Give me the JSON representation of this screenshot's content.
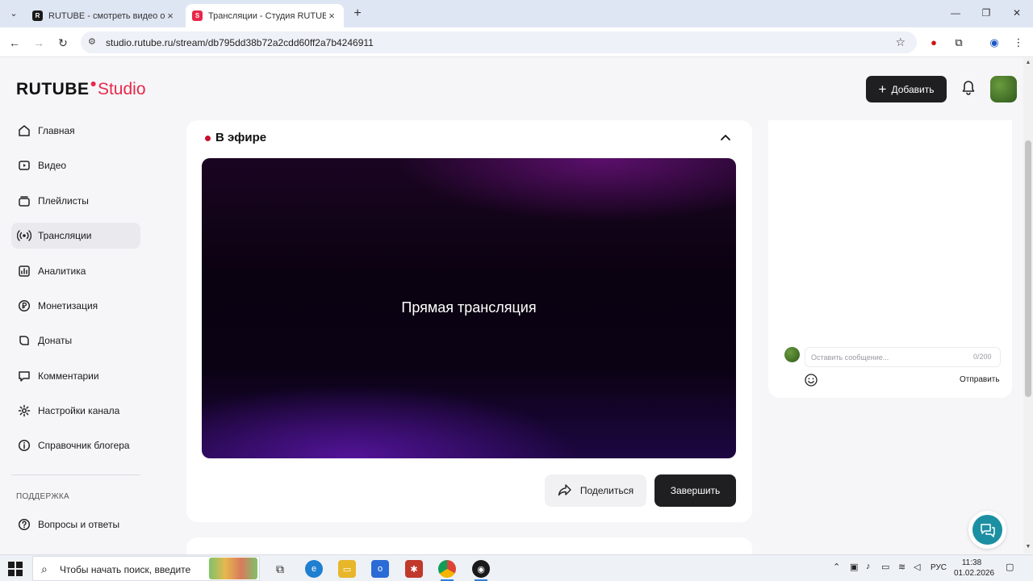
{
  "browser": {
    "tabs": [
      {
        "title": "RUTUBE - смотреть видео онлайн",
        "active": false
      },
      {
        "title": "Трансляции - Студия RUTUBE",
        "active": true
      }
    ],
    "url": "studio.rutube.ru/stream/db795dd38b72a2cdd60ff2a7b4246911"
  },
  "header": {
    "logo_main": "RUTUBE",
    "logo_suffix": "Studio",
    "add_label": "Добавить"
  },
  "sidebar": {
    "items": [
      {
        "label": "Главная",
        "icon": "home-icon"
      },
      {
        "label": "Видео",
        "icon": "video-icon"
      },
      {
        "label": "Плейлисты",
        "icon": "playlist-icon"
      },
      {
        "label": "Трансляции",
        "icon": "broadcast-icon",
        "active": true
      },
      {
        "label": "Аналитика",
        "icon": "analytics-icon"
      },
      {
        "label": "Монетизация",
        "icon": "ruble-icon"
      },
      {
        "label": "Донаты",
        "icon": "donate-icon"
      },
      {
        "label": "Комментарии",
        "icon": "comment-icon"
      },
      {
        "label": "Настройки канала",
        "icon": "gear-icon"
      },
      {
        "label": "Справочник блогера",
        "icon": "info-icon"
      }
    ],
    "support_section": "ПОДДЕРЖКА",
    "support_items": [
      {
        "label": "Вопросы и ответы",
        "icon": "question-icon"
      }
    ]
  },
  "stream": {
    "status_label": "В эфире",
    "player_text": "Прямая трансляция",
    "share_label": "Поделиться",
    "end_label": "Завершить"
  },
  "chat": {
    "placeholder": "Оставить сообщение...",
    "counter": "0/200",
    "send_label": "Отправить"
  },
  "taskbar": {
    "search_placeholder": "Чтобы начать поиск, введите",
    "lang": "РУС",
    "time": "11:38",
    "date": "01.02.2026"
  },
  "colors": {
    "accent": "#e8284a",
    "live": "#c8102e",
    "dark_button": "#1f1f22",
    "support": "#1c8fa3"
  }
}
